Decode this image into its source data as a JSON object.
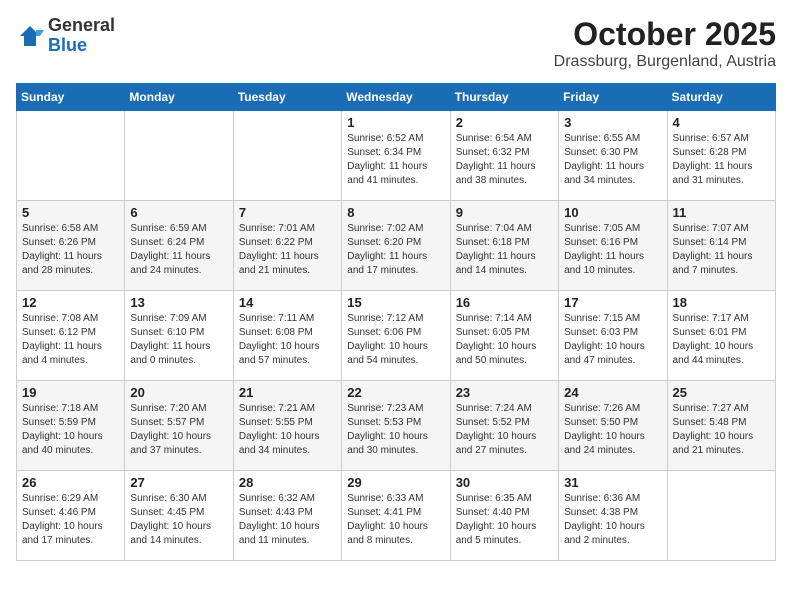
{
  "header": {
    "logo_general": "General",
    "logo_blue": "Blue",
    "month_year": "October 2025",
    "location": "Drassburg, Burgenland, Austria"
  },
  "weekdays": [
    "Sunday",
    "Monday",
    "Tuesday",
    "Wednesday",
    "Thursday",
    "Friday",
    "Saturday"
  ],
  "weeks": [
    [
      {
        "num": "",
        "info": ""
      },
      {
        "num": "",
        "info": ""
      },
      {
        "num": "",
        "info": ""
      },
      {
        "num": "1",
        "info": "Sunrise: 6:52 AM\nSunset: 6:34 PM\nDaylight: 11 hours\nand 41 minutes."
      },
      {
        "num": "2",
        "info": "Sunrise: 6:54 AM\nSunset: 6:32 PM\nDaylight: 11 hours\nand 38 minutes."
      },
      {
        "num": "3",
        "info": "Sunrise: 6:55 AM\nSunset: 6:30 PM\nDaylight: 11 hours\nand 34 minutes."
      },
      {
        "num": "4",
        "info": "Sunrise: 6:57 AM\nSunset: 6:28 PM\nDaylight: 11 hours\nand 31 minutes."
      }
    ],
    [
      {
        "num": "5",
        "info": "Sunrise: 6:58 AM\nSunset: 6:26 PM\nDaylight: 11 hours\nand 28 minutes."
      },
      {
        "num": "6",
        "info": "Sunrise: 6:59 AM\nSunset: 6:24 PM\nDaylight: 11 hours\nand 24 minutes."
      },
      {
        "num": "7",
        "info": "Sunrise: 7:01 AM\nSunset: 6:22 PM\nDaylight: 11 hours\nand 21 minutes."
      },
      {
        "num": "8",
        "info": "Sunrise: 7:02 AM\nSunset: 6:20 PM\nDaylight: 11 hours\nand 17 minutes."
      },
      {
        "num": "9",
        "info": "Sunrise: 7:04 AM\nSunset: 6:18 PM\nDaylight: 11 hours\nand 14 minutes."
      },
      {
        "num": "10",
        "info": "Sunrise: 7:05 AM\nSunset: 6:16 PM\nDaylight: 11 hours\nand 10 minutes."
      },
      {
        "num": "11",
        "info": "Sunrise: 7:07 AM\nSunset: 6:14 PM\nDaylight: 11 hours\nand 7 minutes."
      }
    ],
    [
      {
        "num": "12",
        "info": "Sunrise: 7:08 AM\nSunset: 6:12 PM\nDaylight: 11 hours\nand 4 minutes."
      },
      {
        "num": "13",
        "info": "Sunrise: 7:09 AM\nSunset: 6:10 PM\nDaylight: 11 hours\nand 0 minutes."
      },
      {
        "num": "14",
        "info": "Sunrise: 7:11 AM\nSunset: 6:08 PM\nDaylight: 10 hours\nand 57 minutes."
      },
      {
        "num": "15",
        "info": "Sunrise: 7:12 AM\nSunset: 6:06 PM\nDaylight: 10 hours\nand 54 minutes."
      },
      {
        "num": "16",
        "info": "Sunrise: 7:14 AM\nSunset: 6:05 PM\nDaylight: 10 hours\nand 50 minutes."
      },
      {
        "num": "17",
        "info": "Sunrise: 7:15 AM\nSunset: 6:03 PM\nDaylight: 10 hours\nand 47 minutes."
      },
      {
        "num": "18",
        "info": "Sunrise: 7:17 AM\nSunset: 6:01 PM\nDaylight: 10 hours\nand 44 minutes."
      }
    ],
    [
      {
        "num": "19",
        "info": "Sunrise: 7:18 AM\nSunset: 5:59 PM\nDaylight: 10 hours\nand 40 minutes."
      },
      {
        "num": "20",
        "info": "Sunrise: 7:20 AM\nSunset: 5:57 PM\nDaylight: 10 hours\nand 37 minutes."
      },
      {
        "num": "21",
        "info": "Sunrise: 7:21 AM\nSunset: 5:55 PM\nDaylight: 10 hours\nand 34 minutes."
      },
      {
        "num": "22",
        "info": "Sunrise: 7:23 AM\nSunset: 5:53 PM\nDaylight: 10 hours\nand 30 minutes."
      },
      {
        "num": "23",
        "info": "Sunrise: 7:24 AM\nSunset: 5:52 PM\nDaylight: 10 hours\nand 27 minutes."
      },
      {
        "num": "24",
        "info": "Sunrise: 7:26 AM\nSunset: 5:50 PM\nDaylight: 10 hours\nand 24 minutes."
      },
      {
        "num": "25",
        "info": "Sunrise: 7:27 AM\nSunset: 5:48 PM\nDaylight: 10 hours\nand 21 minutes."
      }
    ],
    [
      {
        "num": "26",
        "info": "Sunrise: 6:29 AM\nSunset: 4:46 PM\nDaylight: 10 hours\nand 17 minutes."
      },
      {
        "num": "27",
        "info": "Sunrise: 6:30 AM\nSunset: 4:45 PM\nDaylight: 10 hours\nand 14 minutes."
      },
      {
        "num": "28",
        "info": "Sunrise: 6:32 AM\nSunset: 4:43 PM\nDaylight: 10 hours\nand 11 minutes."
      },
      {
        "num": "29",
        "info": "Sunrise: 6:33 AM\nSunset: 4:41 PM\nDaylight: 10 hours\nand 8 minutes."
      },
      {
        "num": "30",
        "info": "Sunrise: 6:35 AM\nSunset: 4:40 PM\nDaylight: 10 hours\nand 5 minutes."
      },
      {
        "num": "31",
        "info": "Sunrise: 6:36 AM\nSunset: 4:38 PM\nDaylight: 10 hours\nand 2 minutes."
      },
      {
        "num": "",
        "info": ""
      }
    ]
  ]
}
